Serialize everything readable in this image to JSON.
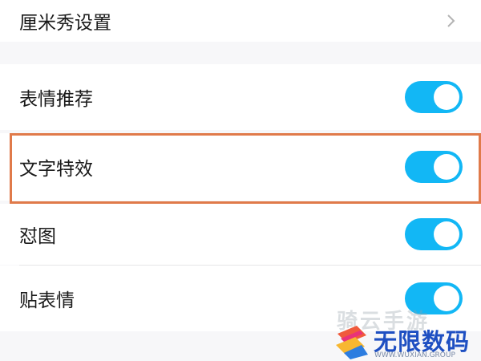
{
  "settings": {
    "rows": [
      {
        "label": "厘米秀设置"
      },
      {
        "label": "表情推荐",
        "enabled": true
      },
      {
        "label": "文字特效",
        "enabled": true
      },
      {
        "label": "怼图",
        "enabled": true
      },
      {
        "label": "贴表情",
        "enabled": true
      }
    ]
  },
  "colors": {
    "toggle_on": "#12b7f5",
    "highlight_border": "#e07a4a",
    "page_background": "#f7f7f9"
  },
  "icons": {
    "row_chevron": "chevron-right-icon"
  },
  "watermark": {
    "faint_text": "骑云手游",
    "brand_name": "无限数码",
    "brand_sub": "WWW.WUXIAN.GROUP"
  }
}
